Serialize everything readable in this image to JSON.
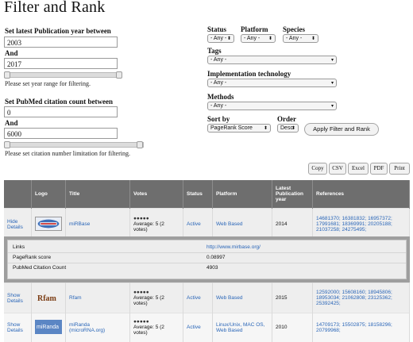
{
  "page": {
    "title": "Filter and Rank"
  },
  "year_filter": {
    "label": "Set latest Publication year between",
    "from": "2003",
    "and_label": "And",
    "to": "2017",
    "help": "Please set year range for filtering."
  },
  "citation_filter": {
    "label": "Set PubMed citation count between",
    "from": "0",
    "and_label": "And",
    "to": "6000",
    "help": "Please set citation number limitation for filtering."
  },
  "filters": {
    "status_label": "Status",
    "status_value": "- Any -",
    "platform_label": "Platform",
    "platform_value": "- Any -",
    "species_label": "Species",
    "species_value": "- Any -",
    "tags_label": "Tags",
    "tags_value": "- Any -",
    "impl_label": "Implementation technology",
    "impl_value": "- Any -",
    "methods_label": "Methods",
    "methods_value": "- Any -",
    "sort_label": "Sort by",
    "sort_value": "PageRank Score",
    "order_label": "Order",
    "order_value": "Desc",
    "apply_label": "Apply Filter and Rank"
  },
  "export": {
    "copy": "Copy",
    "csv": "CSV",
    "excel": "Excel",
    "pdf": "PDF",
    "print": "Print"
  },
  "table": {
    "columns": [
      "",
      "Logo",
      "Title",
      "Votes",
      "Status",
      "Platform",
      "Latest Publication year",
      "References"
    ],
    "rows": [
      {
        "toggle": "Hide Details",
        "logo": "miRBase",
        "title": "miRBase",
        "stars": "●●●●●",
        "average": "Average: 5 (2 votes)",
        "status": "Active",
        "platform": "Web Based",
        "year": "2014",
        "references": "14681370; 16381832; 16957372; 17991681; 18369991; 20205188; 21037258; 24275495;"
      },
      {
        "toggle": "Show Details",
        "logo": "Rfam",
        "title": "Rfam",
        "stars": "●●●●●",
        "average": "Average: 5 (2 votes)",
        "status": "Active",
        "platform": "Web Based",
        "year": "2015",
        "references": "12592000; 15608160; 18945806; 18953034; 21062808; 23125362; 25392425;"
      },
      {
        "toggle": "Show Details",
        "logo": "miRanda",
        "title": "miRanda (microRNA.org)",
        "stars": "●●●●●",
        "average": "Average: 5 (2 votes)",
        "status": "Active",
        "platform": "Linux/Unix, MAC OS, Web Based",
        "year": "2010",
        "references": "14709173; 15502875; 18158296; 20799968;"
      }
    ],
    "detail": {
      "links_label": "Links",
      "links_value": "http://www.mirbase.org/",
      "pagerank_label": "PageRank score",
      "pagerank_value": "0.08997",
      "citation_label": "PubMed Citation Count",
      "citation_value": "4903"
    }
  },
  "colors": {
    "header_bg": "#6e6e6e",
    "link": "#2a66b8",
    "row_bg": "#eeeeee"
  }
}
